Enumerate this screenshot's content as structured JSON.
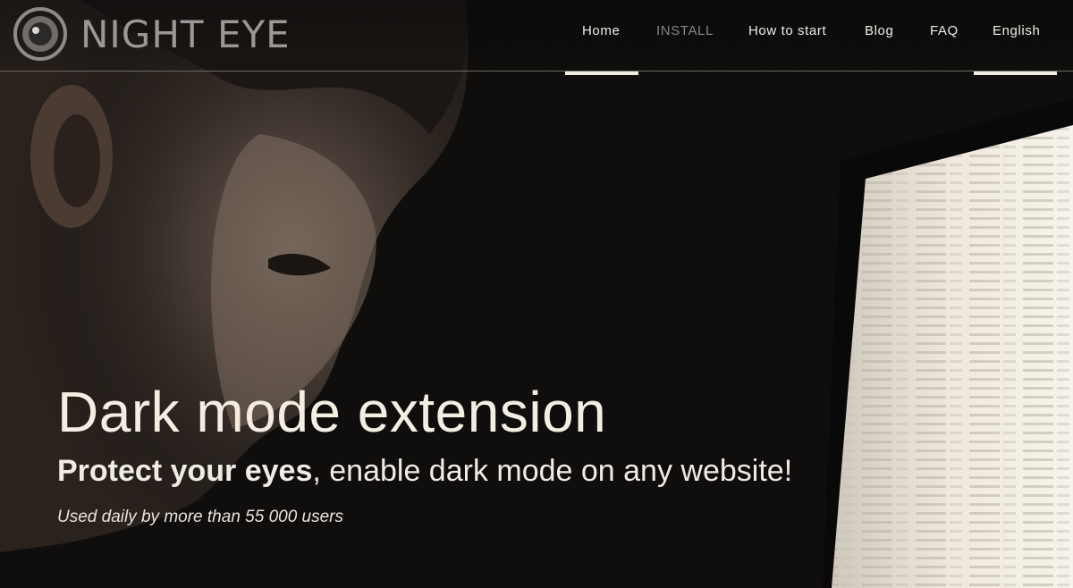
{
  "brand": {
    "name": "NIGHT EYE",
    "logo_icon": "eye-icon"
  },
  "nav": {
    "items": [
      {
        "label": "Home",
        "active": true
      },
      {
        "label": "INSTALL",
        "muted": true
      },
      {
        "label": "How to start"
      },
      {
        "label": "Blog"
      },
      {
        "label": "FAQ"
      },
      {
        "label": "English",
        "active": true
      }
    ]
  },
  "hero": {
    "headline": "Dark mode extension",
    "sub_bold": "Protect your eyes",
    "sub_rest": ", enable dark mode on any website!",
    "tagline": "Used daily by more than 55 000 users"
  },
  "colors": {
    "background": "#0f0e0d",
    "text": "#f3efe6",
    "logo": "#9a9794",
    "accent_underline": "#f1ece1"
  }
}
